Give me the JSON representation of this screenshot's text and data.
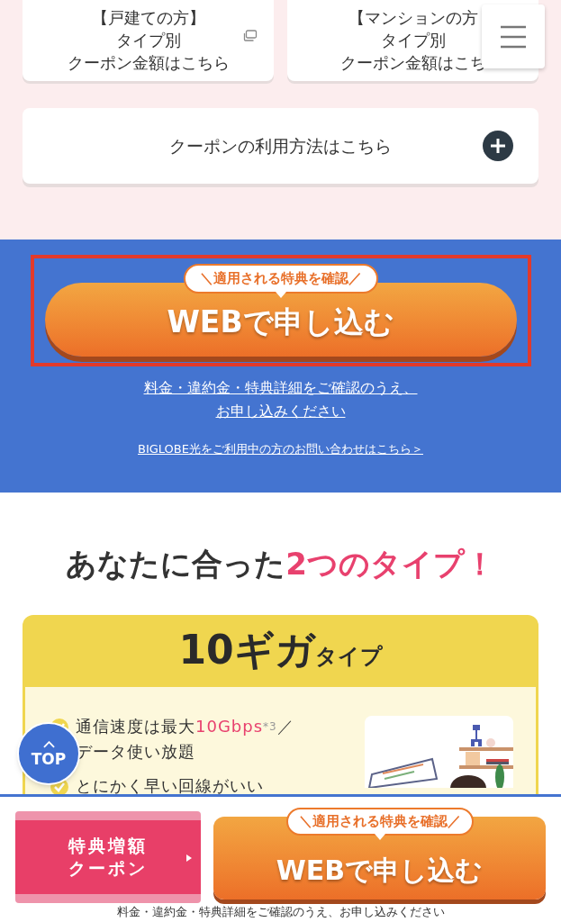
{
  "coupon_cards": [
    {
      "lines": [
        "【戸建ての方】",
        "タイプ別",
        "クーポン金額はこちら"
      ]
    },
    {
      "lines": [
        "【マンションの方",
        "タイプ別",
        "クーポン金額はこち"
      ]
    }
  ],
  "accordion": {
    "label": "クーポンの利用方法はこちら",
    "expanded": false
  },
  "cta": {
    "bubble": "＼適用される特典を確認／",
    "label": "WEBで申し込む",
    "highlighted": true
  },
  "notice_links": [
    "料金・違約金・特典詳細をご確認のうえ、",
    "お申し込みください"
  ],
  "inquiry_link": "BIGLOBE光をご利用中の方のお問い合わせはこちら＞",
  "heading": {
    "plain": "あなたに合った",
    "accent": "2つのタイプ！"
  },
  "plan": {
    "title": "10ギガ",
    "suffix": "タイプ",
    "features": [
      {
        "lines": [
          [
            {
              "t": "通信速度は最大",
              "kind": "plain"
            },
            {
              "t": "10Gbps",
              "kind": "accent"
            },
            {
              "t": "*3",
              "kind": "note"
            },
            {
              "t": "／",
              "kind": "plain"
            }
          ],
          [
            {
              "t": "データ使い放題",
              "kind": "plain"
            }
          ]
        ]
      },
      {
        "lines": [
          [
            {
              "t": "とにかく早い回線がいい",
              "kind": "plain"
            }
          ]
        ]
      }
    ]
  },
  "top_button": "TOP",
  "sticky_bar": {
    "coupon_button": [
      "特典増額",
      "クーポン"
    ],
    "cta": {
      "bubble": "＼適用される特典を確認／",
      "label": "WEBで申し込む"
    },
    "note": "料金・違約金・特典詳細をご確認のうえ、お申し込みください"
  }
}
